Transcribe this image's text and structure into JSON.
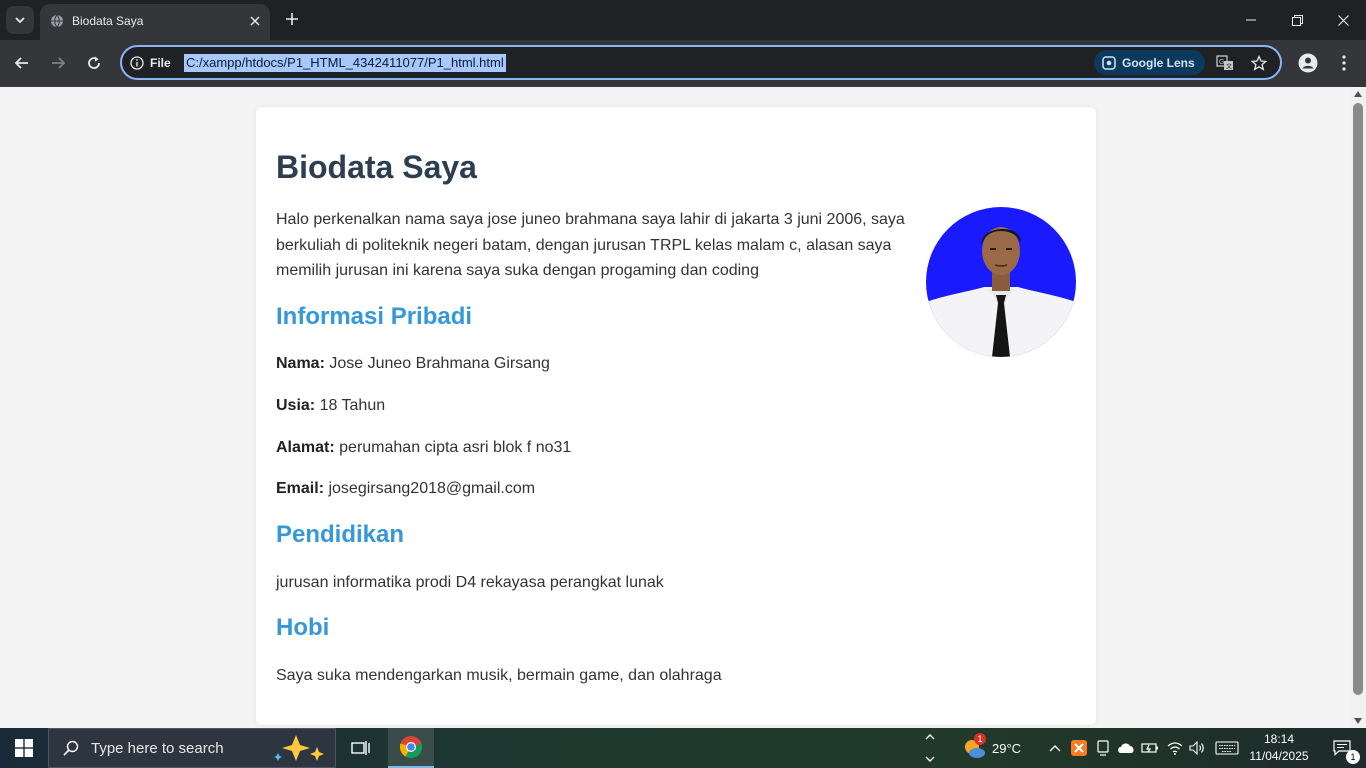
{
  "browser": {
    "tab_title": "Biodata Saya",
    "site_info_label": "File",
    "url": "C:/xampp/htdocs/P1_HTML_4342411077/P1_html.html",
    "lens_label": "Google Lens"
  },
  "page": {
    "title": "Biodata Saya",
    "intro": "Halo perkenalkan nama saya jose juneo brahmana saya lahir di jakarta 3 juni 2006, saya berkuliah di politeknik negeri batam, dengan jurusan TRPL kelas malam c, alasan saya memilih jurusan ini karena saya suka dengan progaming dan coding",
    "personal": {
      "heading": "Informasi Pribadi",
      "name_label": "Nama:",
      "name_value": "Jose Juneo Brahmana Girsang",
      "age_label": "Usia:",
      "age_value": "18 Tahun",
      "address_label": "Alamat:",
      "address_value": "perumahan cipta asri blok f no31",
      "email_label": "Email:",
      "email_value": "josegirsang2018@gmail.com"
    },
    "education": {
      "heading": "Pendidikan",
      "text": "jurusan informatika prodi D4 rekayasa perangkat lunak"
    },
    "hobby": {
      "heading": "Hobi",
      "text": "Saya suka mendengarkan musik, bermain game, dan olahraga"
    },
    "photo_bg_color": "#1a1aff"
  },
  "taskbar": {
    "search_placeholder": "Type here to search",
    "weather_temp": "29°C",
    "weather_badge": "1",
    "time": "18:14",
    "date": "11/04/2025",
    "notification_count": "1"
  },
  "colors": {
    "heading_dark": "#2c3e50",
    "heading_accent": "#3498db",
    "omnibox_border": "#8ab4f8"
  }
}
